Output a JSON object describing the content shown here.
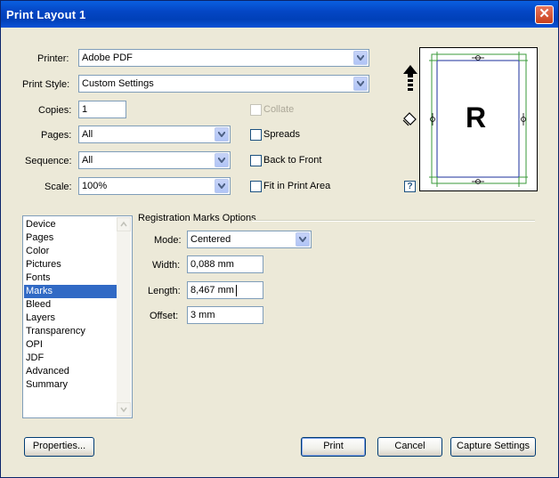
{
  "window": {
    "title": "Print Layout 1",
    "close_glyph": "✕"
  },
  "form": {
    "printer_label": "Printer:",
    "printer_value": "Adobe PDF",
    "print_style_label": "Print Style:",
    "print_style_value": "Custom Settings",
    "copies_label": "Copies:",
    "copies_value": "1",
    "pages_label": "Pages:",
    "pages_value": "All",
    "sequence_label": "Sequence:",
    "sequence_value": "All",
    "scale_label": "Scale:",
    "scale_value": "100%"
  },
  "options": {
    "collate": {
      "label": "Collate",
      "checked": false,
      "enabled": false
    },
    "spreads": {
      "label": "Spreads",
      "checked": false
    },
    "back_to_front": {
      "label": "Back to Front",
      "checked": false
    },
    "fit_in_print_area": {
      "label": "Fit in Print Area",
      "checked": false
    }
  },
  "preview": {
    "letter": "R",
    "help_glyph": "?"
  },
  "panels": {
    "items": [
      "Device",
      "Pages",
      "Color",
      "Pictures",
      "Fonts",
      "Marks",
      "Bleed",
      "Layers",
      "Transparency",
      "OPI",
      "JDF",
      "Advanced",
      "Summary"
    ],
    "selected": "Marks"
  },
  "registration": {
    "group_title": "Registration Marks Options",
    "mode_label": "Mode:",
    "mode_value": "Centered",
    "width_label": "Width:",
    "width_value": "0,088 mm",
    "length_label": "Length:",
    "length_value": "8,467 mm",
    "offset_label": "Offset:",
    "offset_value": "3 mm"
  },
  "buttons": {
    "properties": "Properties...",
    "print": "Print",
    "cancel": "Cancel",
    "capture_settings": "Capture Settings"
  },
  "colors": {
    "title_bar": "#0446c4",
    "selection": "#316ac5",
    "dialog_bg": "#ece9d8"
  }
}
